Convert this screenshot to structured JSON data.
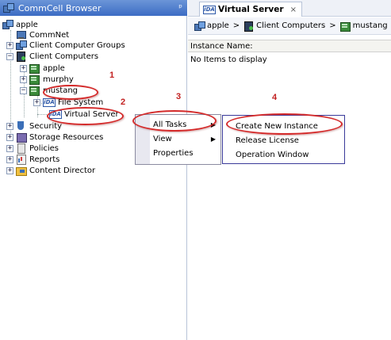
{
  "left_pane": {
    "title": "CommCell Browser",
    "pin_glyph": "ᵖ"
  },
  "tree": {
    "root": "apple",
    "commnet": "CommNet",
    "client_computer_groups": "Client Computer Groups",
    "client_computers": "Client Computers",
    "apple": "apple",
    "murphy": "murphy",
    "mustang": "mustang",
    "file_system": "File System",
    "virtual_server": "Virtual Server",
    "security": "Security",
    "storage_resources": "Storage Resources",
    "policies": "Policies",
    "reports": "Reports",
    "content_director": "Content Director",
    "ida_badge": "iDA"
  },
  "right_pane": {
    "tab_title": "Virtual Server",
    "tab_close": "×",
    "breadcrumb": [
      "apple",
      "Client Computers",
      "mustang"
    ],
    "breadcrumb_sep": ">",
    "column_header": "Instance Name:",
    "empty_text": "No Items to display"
  },
  "context_menu": {
    "items": [
      "All Tasks",
      "View",
      "Properties"
    ]
  },
  "submenu": {
    "items": [
      "Create New Instance",
      "Release License",
      "Operation Window"
    ]
  },
  "annotations": {
    "step1": "1",
    "step2": "2",
    "step3": "3",
    "step4": "4",
    "color": "#d42a2a"
  },
  "colors": {
    "title_bar": "#3c6cc4",
    "menu_border": "#3a3a9a"
  },
  "icons": {
    "browser": "commcell-icon",
    "close": "close-icon",
    "submenu_arrow": "arrow-right-icon"
  }
}
